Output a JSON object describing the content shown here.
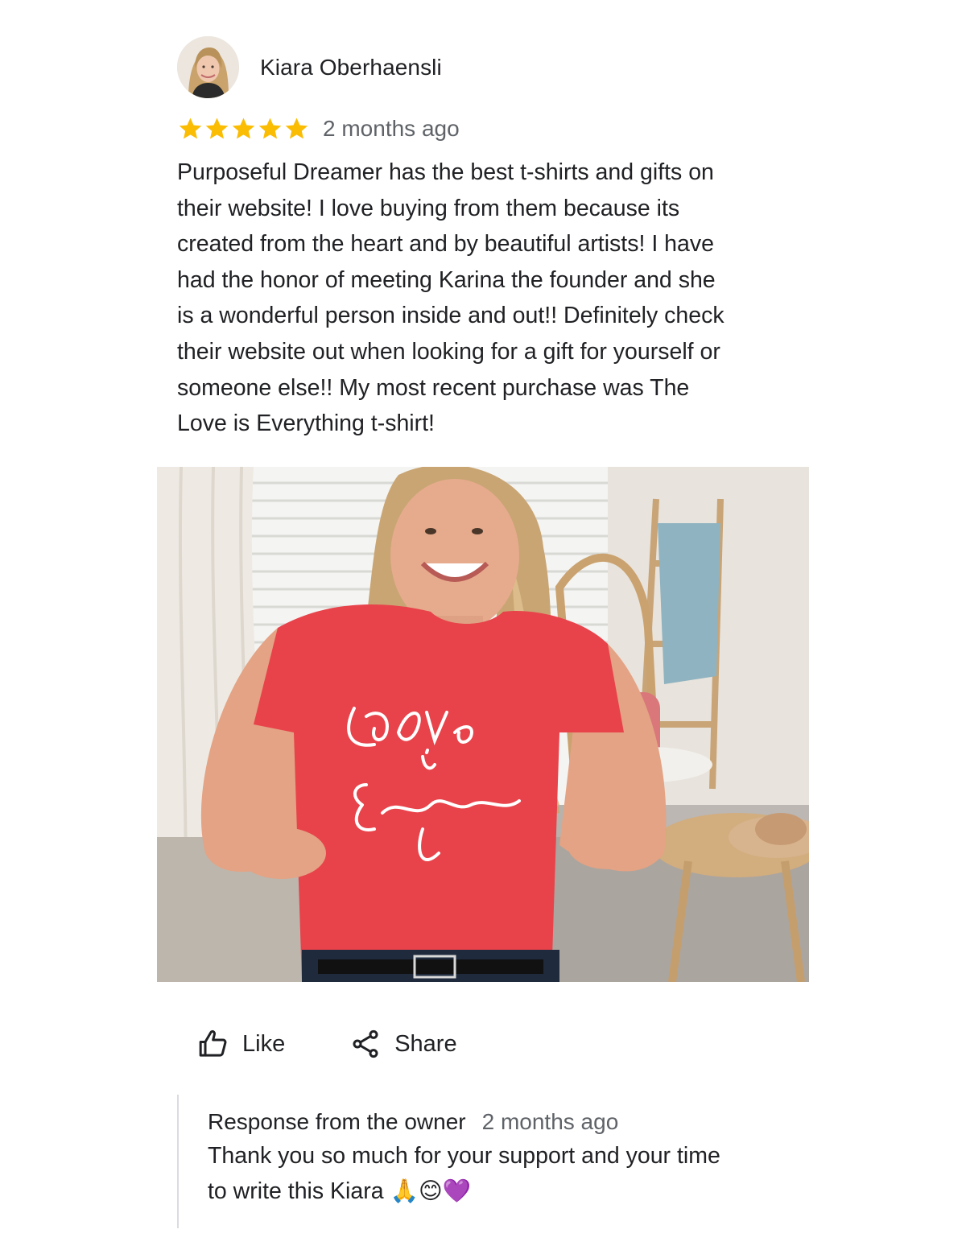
{
  "review": {
    "reviewer_name": "Kiara Oberhaensli",
    "rating": 5,
    "max_rating": 5,
    "date": "2 months ago",
    "text": "Purposeful Dreamer has the best t-shirts and gifts on\ntheir website! I love buying from them because its\ncreated from the heart and by beautiful artists!  I have\nhad the honor of meeting Karina the founder and she\nis a wonderful person inside and out!!  Definitely check\ntheir website out when looking for a gift for yourself or\nsomeone else!!  My most recent purchase was The\nLove is Everything t-shirt!",
    "photo": {
      "shirt_text": [
        "Love",
        "is",
        "Everything"
      ]
    }
  },
  "actions": {
    "like_label": "Like",
    "share_label": "Share"
  },
  "owner_response": {
    "title": "Response from the owner",
    "date": "2 months ago",
    "text": "Thank you so much for your support and your time\nto write this Kiara 🙏😊💜"
  },
  "colors": {
    "star": "#fbbc04",
    "text": "#202124",
    "muted": "#5f6368",
    "divider": "#dadce0",
    "shirt": "#e8424a"
  },
  "icons": {
    "like": "thumbs-up-icon",
    "share": "share-icon",
    "star": "star-icon"
  }
}
